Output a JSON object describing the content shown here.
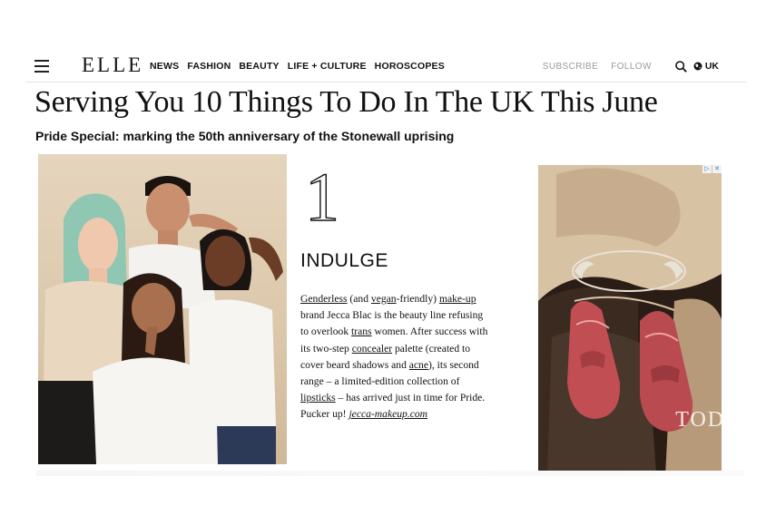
{
  "header": {
    "logo": "ELLE",
    "nav": [
      "NEWS",
      "FASHION",
      "BEAUTY",
      "LIFE + CULTURE",
      "HOROSCOPES"
    ],
    "subscribe": "SUBSCRIBE",
    "follow": "FOLLOW",
    "region": "UK",
    "icons": [
      "menu-icon",
      "search-icon",
      "globe-icon"
    ]
  },
  "article": {
    "headline": "Serving You 10 Things To Do In The UK This June",
    "dek": "Pride Special: marking the 50th anniversary of the Stonewall uprising",
    "item_number": "1",
    "section_title": "INDULGE",
    "body": [
      {
        "t": "Genderless",
        "link": true
      },
      {
        "t": " (and ",
        "link": false
      },
      {
        "t": "vegan",
        "link": true
      },
      {
        "t": "-friendly) ",
        "link": false
      },
      {
        "t": "make-up",
        "link": true
      },
      {
        "t": " brand Jecca Blac is the beauty line refusing to overlook ",
        "link": false
      },
      {
        "t": "trans",
        "link": true
      },
      {
        "t": " women. After success with its two-step ",
        "link": false
      },
      {
        "t": "concealer",
        "link": true
      },
      {
        "t": " palette (created to cover beard shadows and ",
        "link": false
      },
      {
        "t": "acne",
        "link": true
      },
      {
        "t": "), its second range – a limited-edition collection of ",
        "link": false
      },
      {
        "t": "lipsticks",
        "link": true
      },
      {
        "t": " – has arrived just in time for Pride. Pucker up! ",
        "link": false
      }
    ],
    "site_link": "jecca-makeup.com"
  },
  "ad": {
    "brand": "TOD'S",
    "badge": [
      "▷",
      "✕"
    ]
  },
  "colors": {
    "text": "#111111",
    "muted_nav": "#9a9a9a",
    "ad_badge": "#2f7fd6"
  }
}
